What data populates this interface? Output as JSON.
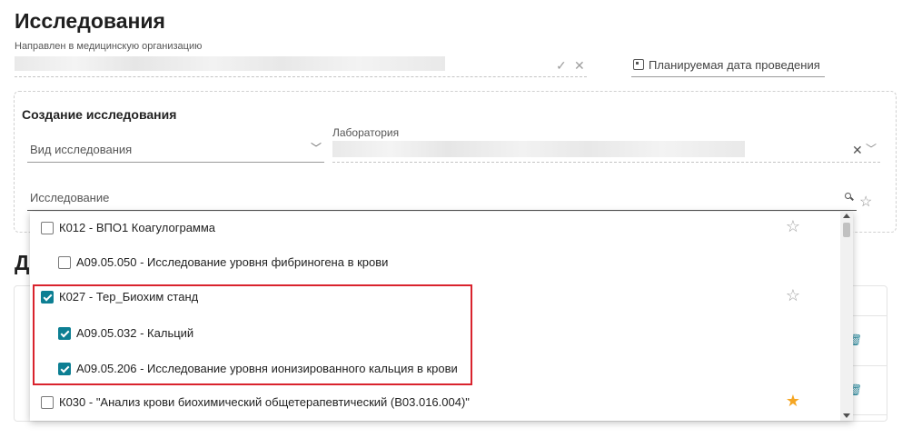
{
  "page": {
    "title": "Исследования"
  },
  "referral": {
    "org_label": "Направлен в медицинскую организацию",
    "check_icon": "check-icon",
    "clear_icon": "close-icon"
  },
  "planned_date": {
    "placeholder": "Планируемая дата проведения",
    "icon": "calendar-icon"
  },
  "create_card": {
    "title": "Создание исследования",
    "study_type_placeholder": "Вид исследования",
    "lab_label": "Лаборатория",
    "study_placeholder": "Исследование"
  },
  "background": {
    "section_letter": "Д"
  },
  "dropdown": {
    "options": [
      {
        "label": "К012 - ВПО1 Коагулограмма",
        "checked": false,
        "starred": false,
        "level": 0
      },
      {
        "label": "A09.05.050 - Исследование уровня фибриногена в крови",
        "checked": false,
        "starred": null,
        "level": 1
      },
      {
        "label": "К027 - Тер_Биохим станд",
        "checked": true,
        "starred": false,
        "level": 0
      },
      {
        "label": "A09.05.032 - Кальций",
        "checked": true,
        "starred": null,
        "level": 1
      },
      {
        "label": "A09.05.206 - Исследование уровня ионизированного кальция в крови",
        "checked": true,
        "starred": null,
        "level": 1
      },
      {
        "label": "К030 - \"Анализ крови биохимический общетерапевтический (B03.016.004)\"",
        "checked": false,
        "starred": true,
        "level": 0
      }
    ]
  },
  "colors": {
    "accent": "#0d7f93",
    "highlight": "#d9232d",
    "star_filled": "#f5a623"
  }
}
